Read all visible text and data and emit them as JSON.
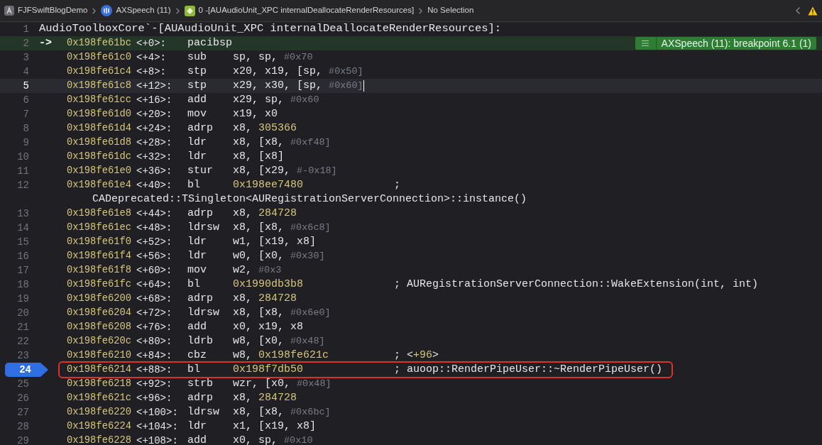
{
  "breadcrumb": [
    {
      "kind": "project",
      "label": "FJFSwiftBlogDemo"
    },
    {
      "kind": "thread",
      "label": "AXSpeech (11)"
    },
    {
      "kind": "frame",
      "label": "0 -[AUAudioUnit_XPC internalDeallocateRenderResources]"
    },
    {
      "kind": "plain",
      "label": "No Selection"
    }
  ],
  "rows": [
    {
      "kind": "label",
      "number": "1",
      "text": "AudioToolboxCore`-[AUAudioUnit_XPC internalDeallocateRenderResources]:"
    },
    {
      "kind": "instruction",
      "number": "2",
      "pc_marker": "->",
      "address": "0x198fe61bc",
      "offset": "<+0>:",
      "mnemonic": "pacibsp",
      "operands": [],
      "badge": "AXSpeech (11): breakpoint 6.1 (1)",
      "pc": true,
      "cursor": false,
      "breakpoint": false,
      "boxed": false
    },
    {
      "kind": "instruction",
      "number": "3",
      "address": "0x198fe61c0",
      "offset": "<+4>:",
      "mnemonic": "sub",
      "operands": [
        {
          "text": "sp, sp, ",
          "kind": "reg"
        },
        {
          "text": "#0x70",
          "kind": "imm"
        }
      ],
      "pc": false,
      "cursor": false,
      "breakpoint": false,
      "boxed": false
    },
    {
      "kind": "instruction",
      "number": "4",
      "address": "0x198fe61c4",
      "offset": "<+8>:",
      "mnemonic": "stp",
      "operands": [
        {
          "text": "x20, x19, [sp, ",
          "kind": "reg"
        },
        {
          "text": "#0x50]",
          "kind": "imm"
        }
      ],
      "pc": false,
      "cursor": false,
      "breakpoint": false,
      "boxed": false
    },
    {
      "kind": "instruction",
      "number": "5",
      "address": "0x198fe61c8",
      "offset": "<+12>:",
      "mnemonic": "stp",
      "operands": [
        {
          "text": "x29, x30, [sp, ",
          "kind": "reg"
        },
        {
          "text": "#0x60]",
          "kind": "imm"
        }
      ],
      "pc": false,
      "cursor": true,
      "breakpoint": false,
      "boxed": false
    },
    {
      "kind": "instruction",
      "number": "6",
      "address": "0x198fe61cc",
      "offset": "<+16>:",
      "mnemonic": "add",
      "operands": [
        {
          "text": "x29, sp, ",
          "kind": "reg"
        },
        {
          "text": "#0x60",
          "kind": "imm"
        }
      ],
      "pc": false,
      "cursor": false,
      "breakpoint": false,
      "boxed": false
    },
    {
      "kind": "instruction",
      "number": "7",
      "address": "0x198fe61d0",
      "offset": "<+20>:",
      "mnemonic": "mov",
      "operands": [
        {
          "text": "x19, x0",
          "kind": "reg"
        }
      ],
      "pc": false,
      "cursor": false,
      "breakpoint": false,
      "boxed": false
    },
    {
      "kind": "instruction",
      "number": "8",
      "address": "0x198fe61d4",
      "offset": "<+24>:",
      "mnemonic": "adrp",
      "operands": [
        {
          "text": "x8, ",
          "kind": "reg"
        },
        {
          "text": "305366",
          "kind": "num"
        }
      ],
      "pc": false,
      "cursor": false,
      "breakpoint": false,
      "boxed": false
    },
    {
      "kind": "instruction",
      "number": "9",
      "address": "0x198fe61d8",
      "offset": "<+28>:",
      "mnemonic": "ldr",
      "operands": [
        {
          "text": "x8, [x8, ",
          "kind": "reg"
        },
        {
          "text": "#0xf48]",
          "kind": "imm"
        }
      ],
      "pc": false,
      "cursor": false,
      "breakpoint": false,
      "boxed": false
    },
    {
      "kind": "instruction",
      "number": "10",
      "address": "0x198fe61dc",
      "offset": "<+32>:",
      "mnemonic": "ldr",
      "operands": [
        {
          "text": "x8, [x8]",
          "kind": "reg"
        }
      ],
      "pc": false,
      "cursor": false,
      "breakpoint": false,
      "boxed": false
    },
    {
      "kind": "instruction",
      "number": "11",
      "address": "0x198fe61e0",
      "offset": "<+36>:",
      "mnemonic": "stur",
      "operands": [
        {
          "text": "x8, [x29, ",
          "kind": "reg"
        },
        {
          "text": "#-0x18]",
          "kind": "imm"
        }
      ],
      "pc": false,
      "cursor": false,
      "breakpoint": false,
      "boxed": false
    },
    {
      "kind": "instruction",
      "number": "12",
      "address": "0x198fe61e4",
      "offset": "<+40>:",
      "mnemonic": "bl",
      "operands": [
        {
          "text": "0x198ee7480",
          "kind": "num"
        }
      ],
      "comment": [
        {
          "text": ";",
          "kind": "reg"
        }
      ],
      "continuation": "CADeprecated::TSingleton<AURegistrationServerConnection>::instance()",
      "pc": false,
      "cursor": false,
      "breakpoint": false,
      "boxed": false
    },
    {
      "kind": "instruction",
      "number": "13",
      "address": "0x198fe61e8",
      "offset": "<+44>:",
      "mnemonic": "adrp",
      "operands": [
        {
          "text": "x8, ",
          "kind": "reg"
        },
        {
          "text": "284728",
          "kind": "num"
        }
      ],
      "pc": false,
      "cursor": false,
      "breakpoint": false,
      "boxed": false
    },
    {
      "kind": "instruction",
      "number": "14",
      "address": "0x198fe61ec",
      "offset": "<+48>:",
      "mnemonic": "ldrsw",
      "operands": [
        {
          "text": "x8, [x8, ",
          "kind": "reg"
        },
        {
          "text": "#0x6c8]",
          "kind": "imm"
        }
      ],
      "pc": false,
      "cursor": false,
      "breakpoint": false,
      "boxed": false
    },
    {
      "kind": "instruction",
      "number": "15",
      "address": "0x198fe61f0",
      "offset": "<+52>:",
      "mnemonic": "ldr",
      "operands": [
        {
          "text": "w1, [x19, x8]",
          "kind": "reg"
        }
      ],
      "pc": false,
      "cursor": false,
      "breakpoint": false,
      "boxed": false
    },
    {
      "kind": "instruction",
      "number": "16",
      "address": "0x198fe61f4",
      "offset": "<+56>:",
      "mnemonic": "ldr",
      "operands": [
        {
          "text": "w0, [x0, ",
          "kind": "reg"
        },
        {
          "text": "#0x30]",
          "kind": "imm"
        }
      ],
      "pc": false,
      "cursor": false,
      "breakpoint": false,
      "boxed": false
    },
    {
      "kind": "instruction",
      "number": "17",
      "address": "0x198fe61f8",
      "offset": "<+60>:",
      "mnemonic": "mov",
      "operands": [
        {
          "text": "w2, ",
          "kind": "reg"
        },
        {
          "text": "#0x3",
          "kind": "imm"
        }
      ],
      "pc": false,
      "cursor": false,
      "breakpoint": false,
      "boxed": false
    },
    {
      "kind": "instruction",
      "number": "18",
      "address": "0x198fe61fc",
      "offset": "<+64>:",
      "mnemonic": "bl",
      "operands": [
        {
          "text": "0x1990db3b8",
          "kind": "num"
        }
      ],
      "comment": [
        {
          "text": "; AURegistrationServerConnection::WakeExtension(int, int)",
          "kind": "reg"
        }
      ],
      "pc": false,
      "cursor": false,
      "breakpoint": false,
      "boxed": false
    },
    {
      "kind": "instruction",
      "number": "19",
      "address": "0x198fe6200",
      "offset": "<+68>:",
      "mnemonic": "adrp",
      "operands": [
        {
          "text": "x8, ",
          "kind": "reg"
        },
        {
          "text": "284728",
          "kind": "num"
        }
      ],
      "pc": false,
      "cursor": false,
      "breakpoint": false,
      "boxed": false
    },
    {
      "kind": "instruction",
      "number": "20",
      "address": "0x198fe6204",
      "offset": "<+72>:",
      "mnemonic": "ldrsw",
      "operands": [
        {
          "text": "x8, [x8, ",
          "kind": "reg"
        },
        {
          "text": "#0x6e0]",
          "kind": "imm"
        }
      ],
      "pc": false,
      "cursor": false,
      "breakpoint": false,
      "boxed": false
    },
    {
      "kind": "instruction",
      "number": "21",
      "address": "0x198fe6208",
      "offset": "<+76>:",
      "mnemonic": "add",
      "operands": [
        {
          "text": "x0, x19, x8",
          "kind": "reg"
        }
      ],
      "pc": false,
      "cursor": false,
      "breakpoint": false,
      "boxed": false
    },
    {
      "kind": "instruction",
      "number": "22",
      "address": "0x198fe620c",
      "offset": "<+80>:",
      "mnemonic": "ldrb",
      "operands": [
        {
          "text": "w8, [x0, ",
          "kind": "reg"
        },
        {
          "text": "#0x48]",
          "kind": "imm"
        }
      ],
      "pc": false,
      "cursor": false,
      "breakpoint": false,
      "boxed": false
    },
    {
      "kind": "instruction",
      "number": "23",
      "address": "0x198fe6210",
      "offset": "<+84>:",
      "mnemonic": "cbz",
      "operands": [
        {
          "text": "w8, ",
          "kind": "reg"
        },
        {
          "text": "0x198fe621c",
          "kind": "num"
        }
      ],
      "comment": [
        {
          "text": "; <",
          "kind": "reg"
        },
        {
          "text": "+96",
          "kind": "num"
        },
        {
          "text": ">",
          "kind": "reg"
        }
      ],
      "pc": false,
      "cursor": false,
      "breakpoint": false,
      "boxed": false
    },
    {
      "kind": "instruction",
      "number": "24",
      "address": "0x198fe6214",
      "offset": "<+88>:",
      "mnemonic": "bl",
      "operands": [
        {
          "text": "0x198f7db50",
          "kind": "num"
        }
      ],
      "comment": [
        {
          "text": "; auoop::RenderPipeUser::~RenderPipeUser()",
          "kind": "reg"
        }
      ],
      "pc": false,
      "cursor": false,
      "breakpoint": true,
      "boxed": true
    },
    {
      "kind": "instruction",
      "number": "25",
      "address": "0x198fe6218",
      "offset": "<+92>:",
      "mnemonic": "strb",
      "operands": [
        {
          "text": "wzr, [x0, ",
          "kind": "reg"
        },
        {
          "text": "#0x48]",
          "kind": "imm"
        }
      ],
      "pc": false,
      "cursor": false,
      "breakpoint": false,
      "boxed": false
    },
    {
      "kind": "instruction",
      "number": "26",
      "address": "0x198fe621c",
      "offset": "<+96>:",
      "mnemonic": "adrp",
      "operands": [
        {
          "text": "x8, ",
          "kind": "reg"
        },
        {
          "text": "284728",
          "kind": "num"
        }
      ],
      "pc": false,
      "cursor": false,
      "breakpoint": false,
      "boxed": false
    },
    {
      "kind": "instruction",
      "number": "27",
      "address": "0x198fe6220",
      "offset": "<+100>:",
      "mnemonic": "ldrsw",
      "operands": [
        {
          "text": "x8, [x8, ",
          "kind": "reg"
        },
        {
          "text": "#0x6bc]",
          "kind": "imm"
        }
      ],
      "pc": false,
      "cursor": false,
      "breakpoint": false,
      "boxed": false
    },
    {
      "kind": "instruction",
      "number": "28",
      "address": "0x198fe6224",
      "offset": "<+104>:",
      "mnemonic": "ldr",
      "operands": [
        {
          "text": "x1, [x19, x8]",
          "kind": "reg"
        }
      ],
      "pc": false,
      "cursor": false,
      "breakpoint": false,
      "boxed": false
    },
    {
      "kind": "instruction",
      "number": "29",
      "address": "0x198fe6228",
      "offset": "<+108>:",
      "mnemonic": "add",
      "operands": [
        {
          "text": "x0, sp, ",
          "kind": "reg"
        },
        {
          "text": "#0x10",
          "kind": "imm"
        }
      ],
      "pc": false,
      "cursor": false,
      "breakpoint": false,
      "boxed": false
    }
  ]
}
